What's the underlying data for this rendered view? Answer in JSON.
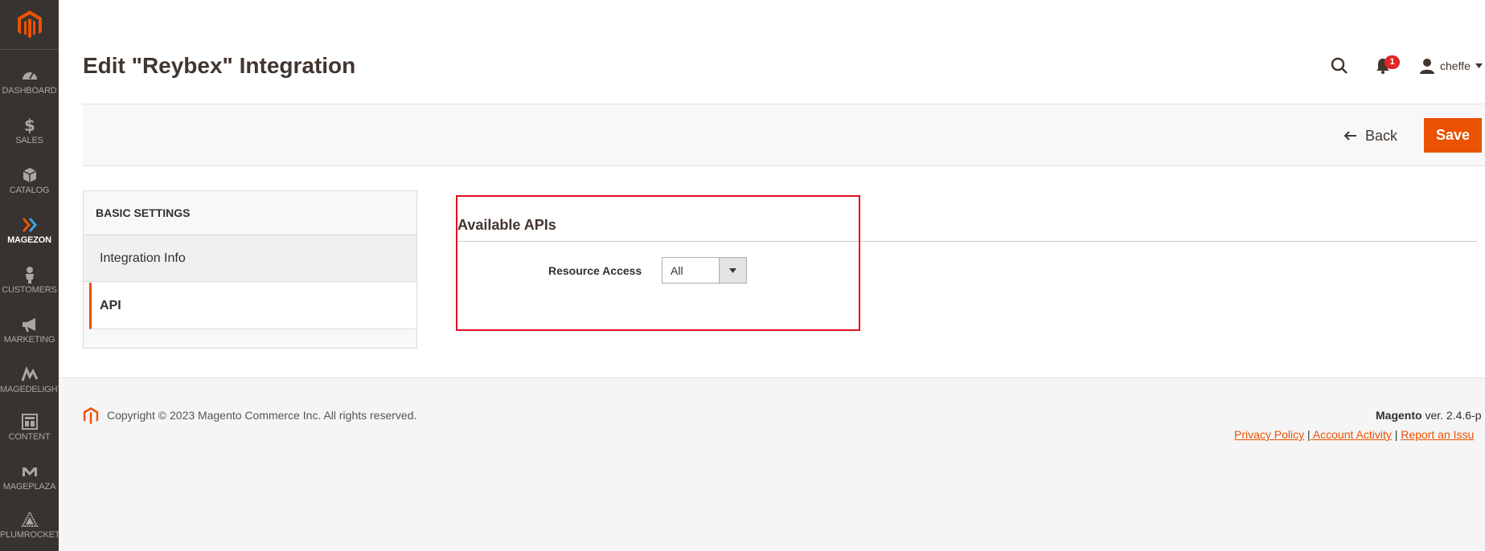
{
  "sidebar": {
    "logo": "magento-logo",
    "items": [
      {
        "label": "Dashboard",
        "icon": "dashboard-icon"
      },
      {
        "label": "Sales",
        "icon": "dollar-icon"
      },
      {
        "label": "Catalog",
        "icon": "box-icon"
      },
      {
        "label": "Magezon",
        "icon": "magezon-icon",
        "active": true
      },
      {
        "label": "Customers",
        "icon": "person-icon"
      },
      {
        "label": "Marketing",
        "icon": "megaphone-icon"
      },
      {
        "label": "Magedelight",
        "icon": "magedelight-icon"
      },
      {
        "label": "Content",
        "icon": "layout-icon"
      },
      {
        "label": "Mageplaza",
        "icon": "mageplaza-icon"
      },
      {
        "label": "Plumrocket",
        "icon": "plumrocket-icon"
      }
    ]
  },
  "header": {
    "title": "Edit \"Reybex\" Integration",
    "notification_count": "1",
    "username": "cheffe"
  },
  "actions": {
    "back_label": "Back",
    "save_label": "Save"
  },
  "tabs": {
    "title": "BASIC SETTINGS",
    "items": [
      {
        "label": "Integration Info"
      },
      {
        "label": "API",
        "active": true
      }
    ]
  },
  "main": {
    "section_title": "Available APIs",
    "resource_access_label": "Resource Access",
    "resource_access_value": "All"
  },
  "footer": {
    "copyright": "Copyright © 2023 Magento Commerce Inc. All rights reserved.",
    "brand": "Magento",
    "version": " ver. 2.4.6-p",
    "links": [
      "Privacy Policy",
      " Account Activity",
      "Report an Issu"
    ]
  },
  "colors": {
    "accent": "#eb5202",
    "sidebar_bg": "#373330",
    "highlight": "#e0121d"
  }
}
